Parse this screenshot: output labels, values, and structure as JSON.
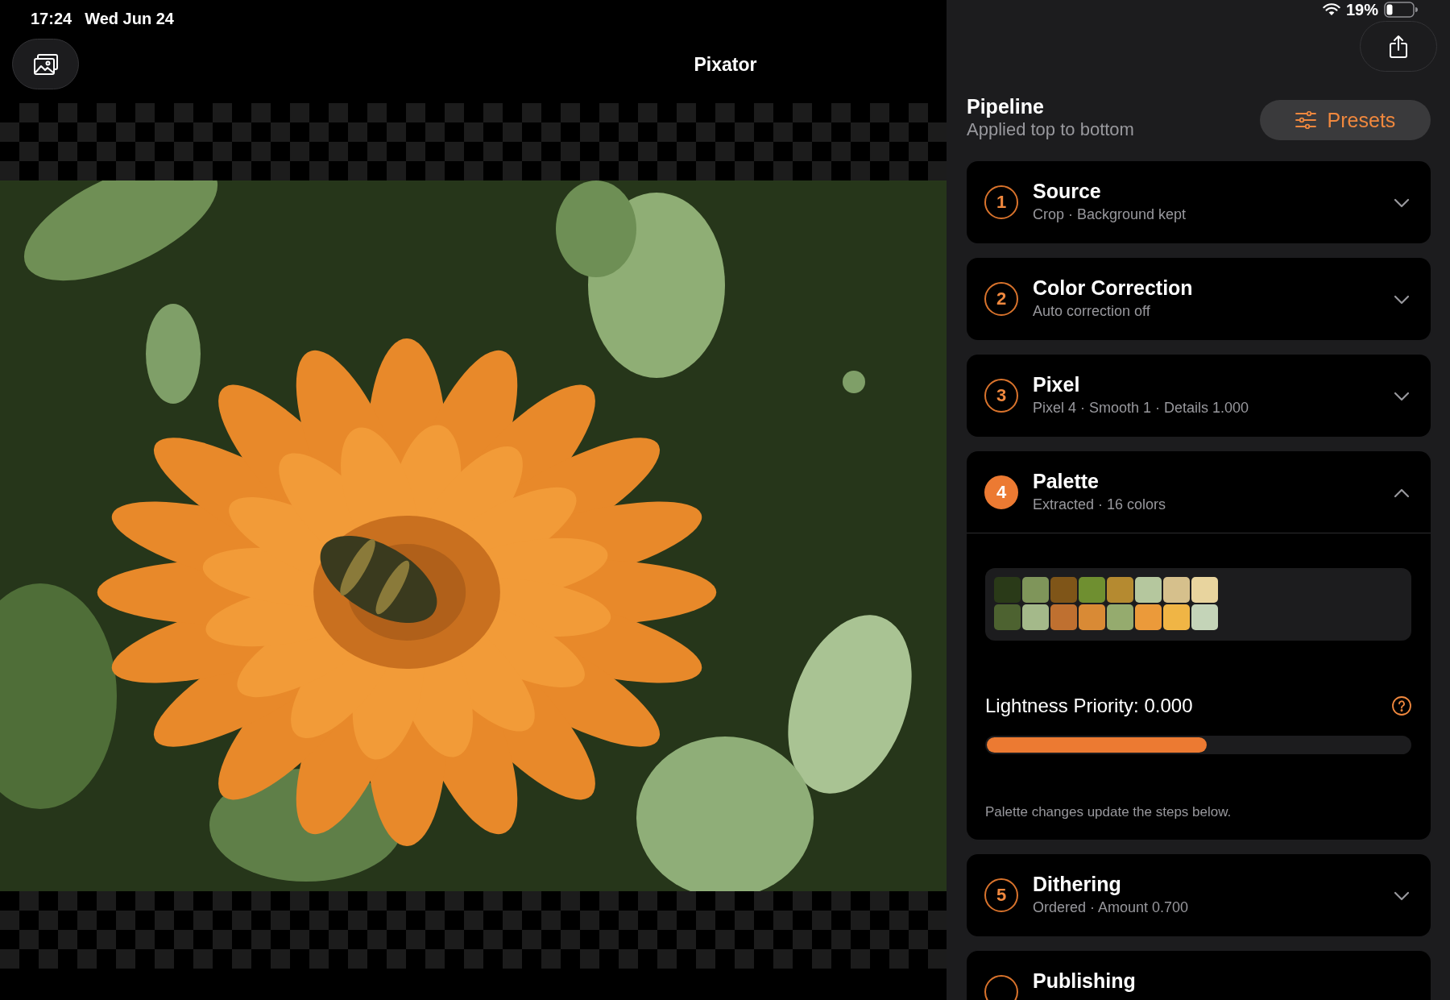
{
  "status_bar": {
    "time": "17:24",
    "date": "Wed Jun 24",
    "battery": "19%"
  },
  "toolbar": {
    "title": "Pixator"
  },
  "pipeline": {
    "title": "Pipeline",
    "subtitle": "Applied top to bottom",
    "presets_button": "Presets"
  },
  "steps": [
    {
      "number": "1",
      "title": "Source",
      "summary": "Crop · Background kept",
      "expanded": false
    },
    {
      "number": "2",
      "title": "Color Correction",
      "summary": "Auto correction off",
      "expanded": false
    },
    {
      "number": "3",
      "title": "Pixel",
      "summary": "Pixel 4 · Smooth 1 · Details 1.000",
      "expanded": false
    },
    {
      "number": "4",
      "title": "Palette",
      "summary": "Extracted · 16 colors",
      "expanded": true,
      "palette": [
        {
          "color": "#2a3a18"
        },
        {
          "color": "#7f955a"
        },
        {
          "color": "#7f5518"
        },
        {
          "color": "#6f8f30"
        },
        {
          "color": "#b58a30"
        },
        {
          "color": "#b5c79e"
        },
        {
          "color": "#d6c08c"
        },
        {
          "color": "#e8d49e"
        },
        {
          "color": "#4d6230"
        },
        {
          "color": "#a4b98a"
        },
        {
          "color": "#bf7030"
        },
        {
          "color": "#d98a35"
        },
        {
          "color": "#95ab6e"
        },
        {
          "color": "#eb9a3a"
        },
        {
          "color": "#f0b545"
        },
        {
          "color": "#c4d4b8"
        }
      ],
      "slider": {
        "label": "Lightness Priority: 0.000",
        "level": 0.52
      },
      "note": "Palette changes update the steps below."
    },
    {
      "number": "5",
      "title": "Dithering",
      "summary": "Ordered · Amount 0.700",
      "expanded": false
    },
    {
      "title": "Publishing",
      "expanded": false
    }
  ]
}
